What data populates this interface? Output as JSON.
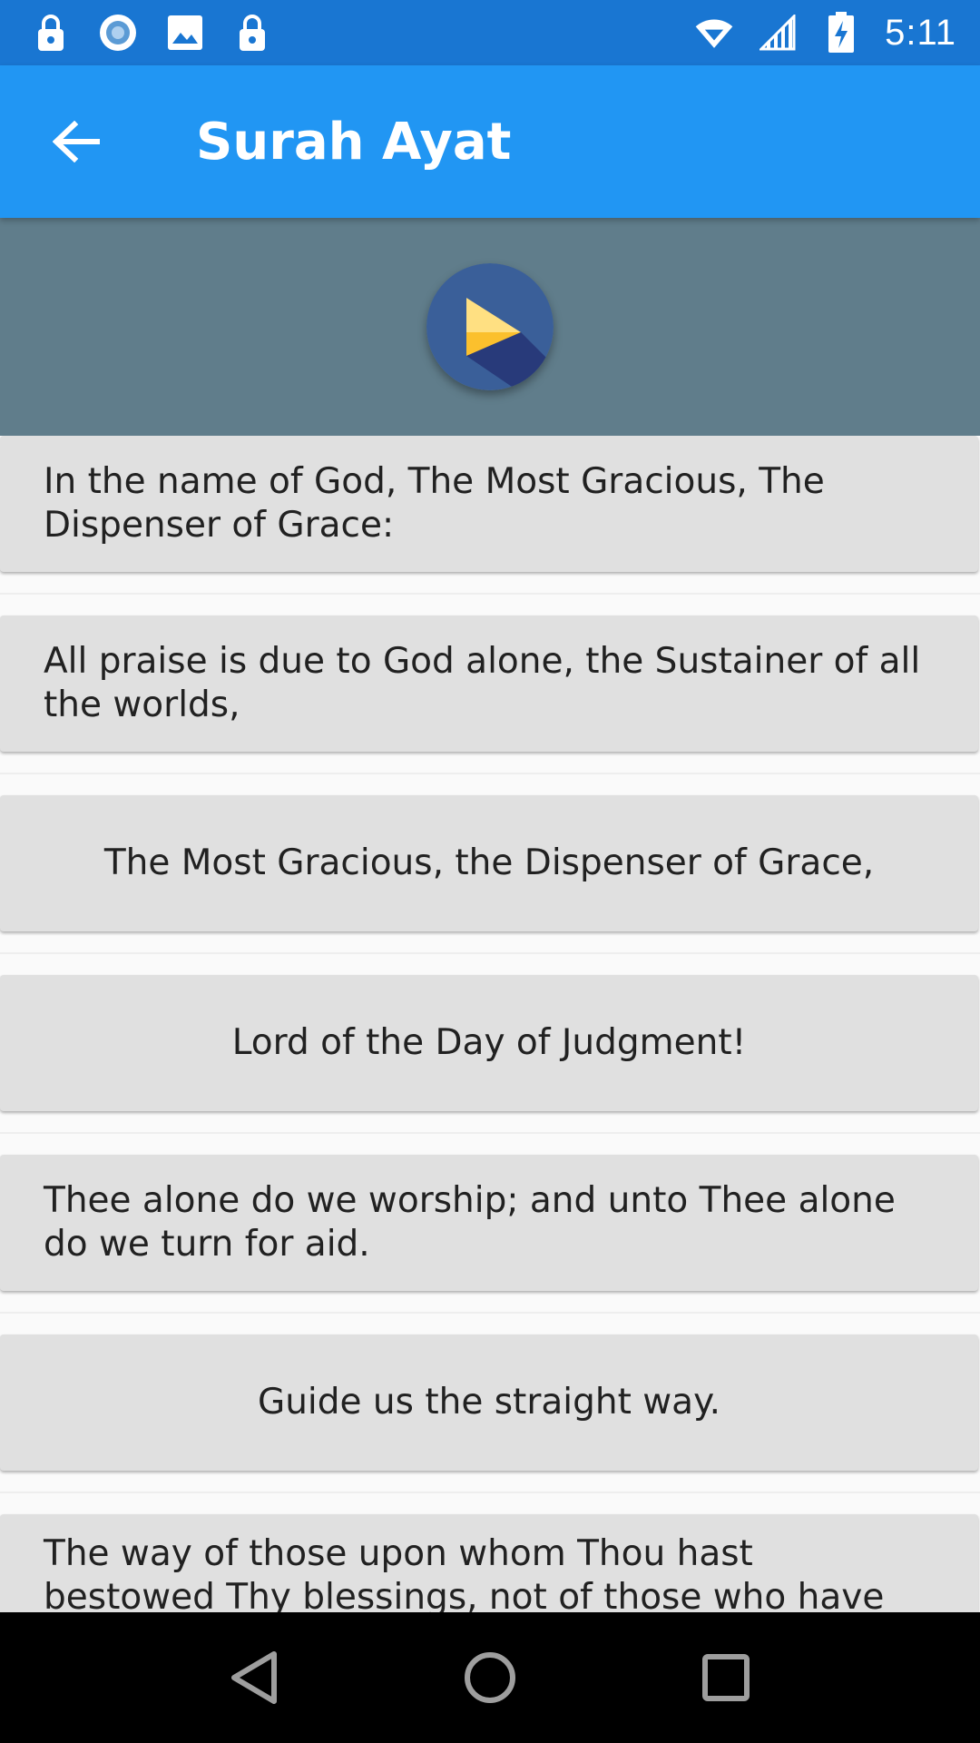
{
  "status_bar": {
    "time": "5:11",
    "left_icons": [
      "lock-icon",
      "circle-notification-icon",
      "image-icon",
      "lock-icon"
    ],
    "right_icons": [
      "wifi-icon",
      "cell-signal-icon",
      "battery-charging-icon"
    ]
  },
  "app_bar": {
    "title": "Surah Ayat",
    "back_icon": "arrow-back-icon",
    "color": "#2196f3"
  },
  "player": {
    "icon": "play-icon",
    "background": "#607d8b"
  },
  "ayat": [
    {
      "text": "In the name of God, The Most Gracious, The Dispenser of Grace:"
    },
    {
      "text": "All praise is due to God alone, the Sustainer of all the worlds,"
    },
    {
      "text": "The Most Gracious, the Dispenser of Grace,"
    },
    {
      "text": "Lord of the Day of Judgment!"
    },
    {
      "text": "Thee alone do we worship; and unto Thee alone do we turn for aid."
    },
    {
      "text": "Guide us the straight way."
    },
    {
      "text": "The way of those upon whom Thou hast bestowed Thy blessings, not of those who have been condemned [by Thee], nor of those who go astray!"
    }
  ],
  "nav_bar": {
    "icons": [
      "back-triangle-icon",
      "home-circle-icon",
      "recents-square-icon"
    ]
  }
}
